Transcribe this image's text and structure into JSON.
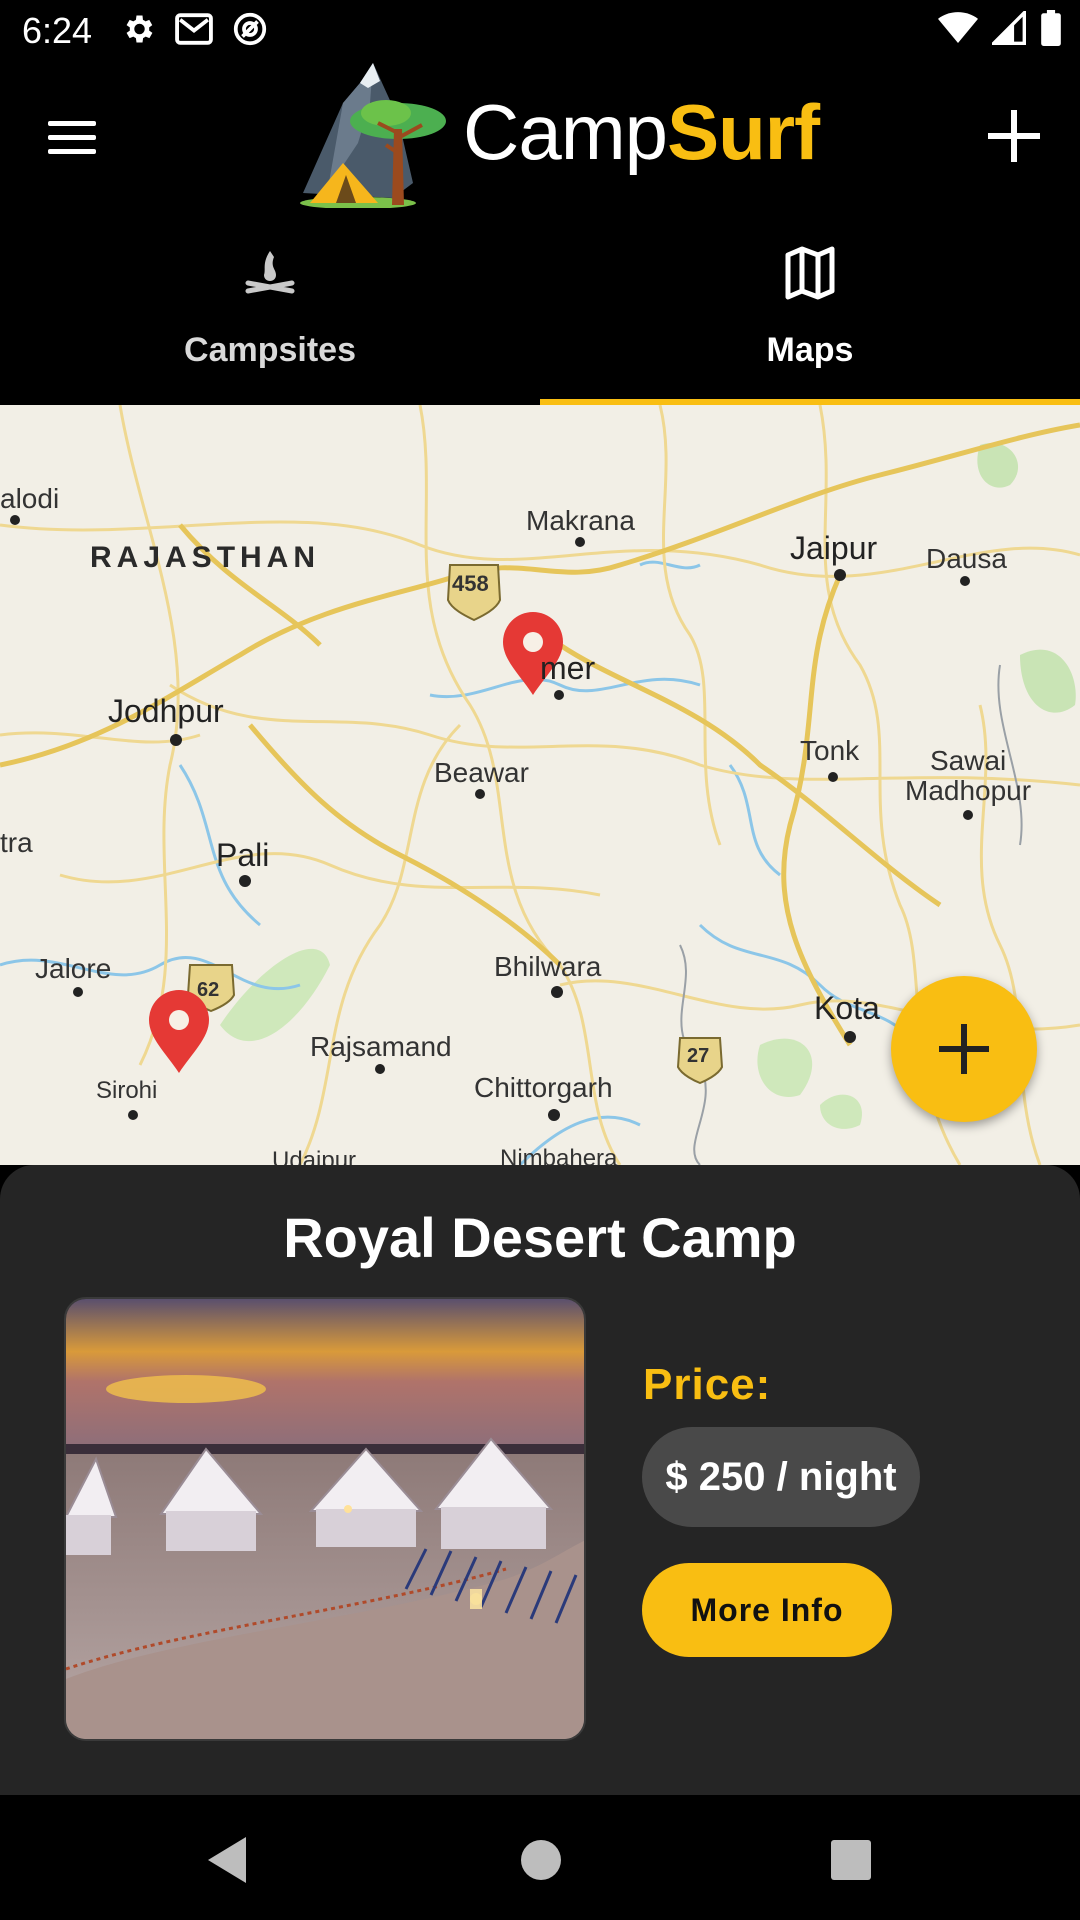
{
  "status_bar": {
    "time": "6:24",
    "left_icons": [
      "gear-icon",
      "gmail-icon",
      "at-sign-icon"
    ],
    "right_icons": [
      "wifi-icon",
      "signal-icon",
      "battery-icon"
    ]
  },
  "app_bar": {
    "brand_part1": "Camp",
    "brand_part2": "Surf",
    "menu_icon": "menu-icon",
    "add_icon": "plus-icon"
  },
  "tabs": [
    {
      "label": "Campsites",
      "icon": "campfire-icon",
      "selected": false
    },
    {
      "label": "Maps",
      "icon": "map-icon",
      "selected": true
    }
  ],
  "map": {
    "state_label": "RAJASTHAN",
    "cities": [
      {
        "name": "Makrana"
      },
      {
        "name": "Jaipur"
      },
      {
        "name": "Dausa"
      },
      {
        "name": "Jodhpur"
      },
      {
        "name": "Beawar"
      },
      {
        "name": "Tonk"
      },
      {
        "name": "Sawai"
      },
      {
        "name": "Madhopur"
      },
      {
        "name": "Pali"
      },
      {
        "name": "Jalore"
      },
      {
        "name": "Bhilwara"
      },
      {
        "name": "Kota"
      },
      {
        "name": "Rajsamand"
      },
      {
        "name": "Sirohi"
      },
      {
        "name": "Chittorgarh"
      },
      {
        "name": "Nimbahera"
      },
      {
        "name": "Udaipur"
      },
      {
        "name": "alodi"
      },
      {
        "name": "tra"
      },
      {
        "name": "mer"
      }
    ],
    "highway_shields": [
      "458",
      "62",
      "27"
    ],
    "markers": 2
  },
  "fab": {
    "icon": "plus-icon"
  },
  "card": {
    "title": "Royal Desert Camp",
    "price_label": "Price:",
    "price_value": "$ 250 / night",
    "more_info_label": "More Info"
  },
  "colors": {
    "accent": "#f9be12",
    "background": "#000000",
    "card": "#252525",
    "marker": "#e53935"
  }
}
